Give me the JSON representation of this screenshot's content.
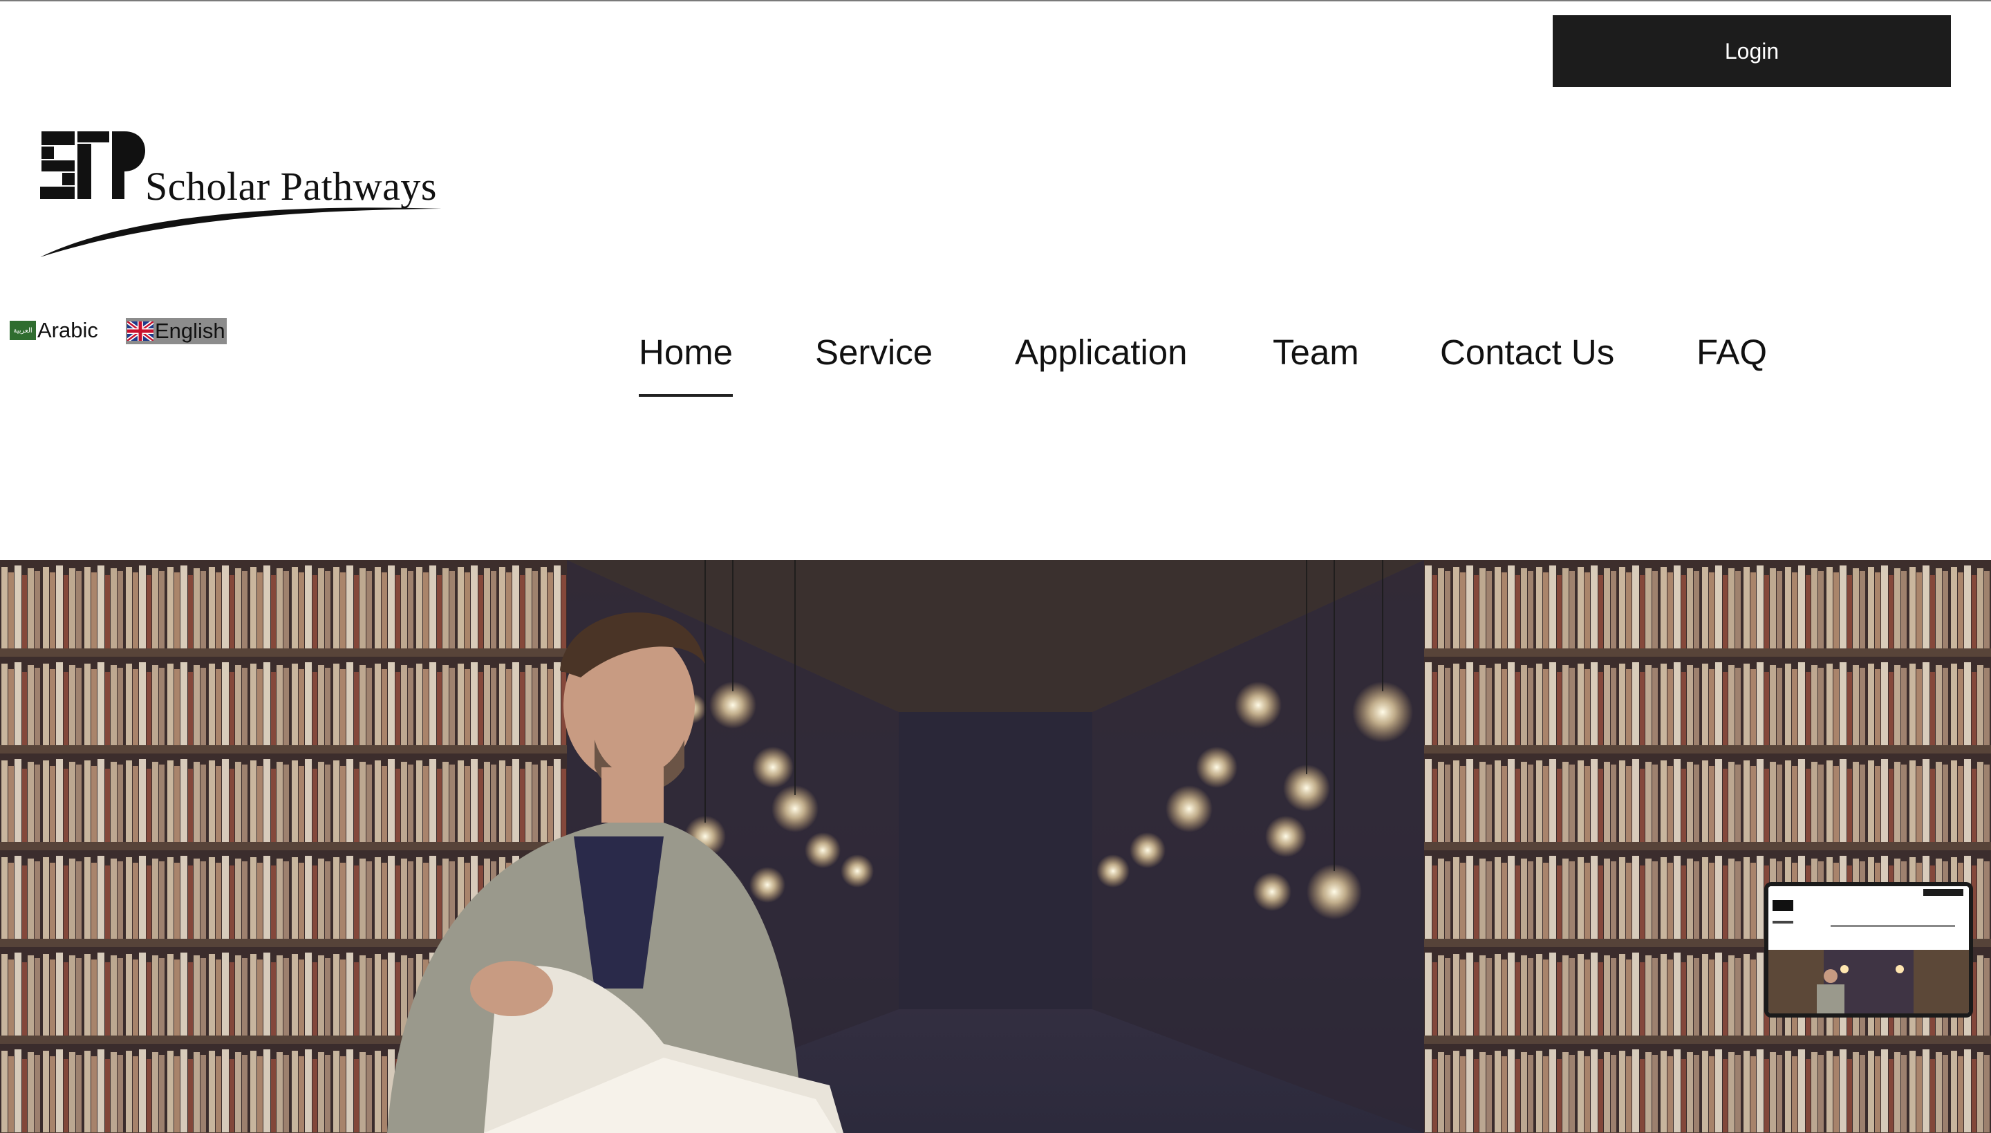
{
  "header": {
    "login_label": "Login"
  },
  "logo": {
    "mark_text": "SP",
    "name": "Scholar Pathways"
  },
  "languages": [
    {
      "label": "Arabic",
      "flag_text": "العربية",
      "selected": false
    },
    {
      "label": "English",
      "selected": true
    }
  ],
  "nav": {
    "items": [
      {
        "label": "Home",
        "active": true
      },
      {
        "label": "Service",
        "active": false
      },
      {
        "label": "Application",
        "active": false
      },
      {
        "label": "Team",
        "active": false
      },
      {
        "label": "Contact Us",
        "active": false
      },
      {
        "label": "FAQ",
        "active": false
      }
    ]
  },
  "hero": {
    "image": "library-student-reading-photo"
  },
  "preview_thumbnail": {
    "image": "page-preview-thumbnail"
  },
  "colors": {
    "login_bg": "#1c1c1c",
    "text": "#111111",
    "english_highlight": "#8c8c8c"
  }
}
